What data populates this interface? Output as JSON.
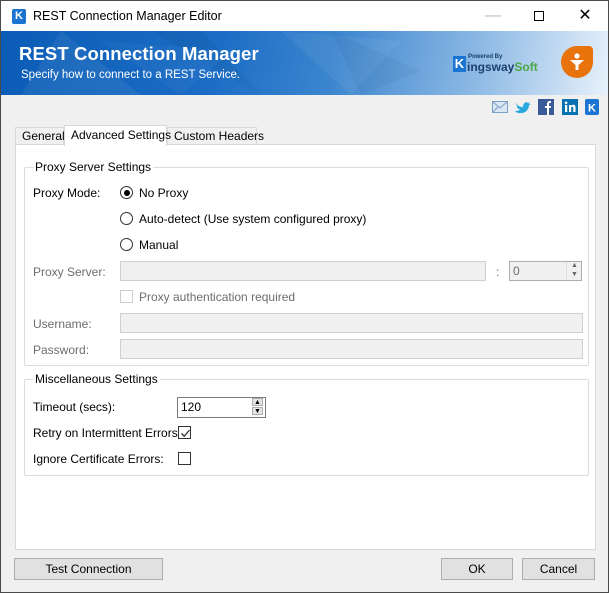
{
  "window": {
    "title": "REST Connection Manager Editor",
    "controls": {
      "minimize": "minimize",
      "maximize": "maximize",
      "close": "close"
    }
  },
  "banner": {
    "title": "REST Connection Manager",
    "subtitle": "Specify how to connect to a REST Service.",
    "logo": {
      "k": "K",
      "powered_by": "Powered By",
      "name_part1": "ingsway",
      "name_part2": "Soft"
    }
  },
  "social_icons": [
    "email-icon",
    "twitter-icon",
    "facebook-icon",
    "linkedin-icon",
    "kingswaysoft-icon"
  ],
  "tabs": [
    {
      "label": "General",
      "active": false
    },
    {
      "label": "Advanced Settings",
      "active": true
    },
    {
      "label": "Custom Headers",
      "active": false
    }
  ],
  "proxy": {
    "group_title": "Proxy Server Settings",
    "mode_label": "Proxy Mode:",
    "options": [
      {
        "label": "No Proxy",
        "selected": true
      },
      {
        "label": "Auto-detect (Use system configured proxy)",
        "selected": false
      },
      {
        "label": "Manual",
        "selected": false
      }
    ],
    "server_label": "Proxy Server:",
    "server_value": "",
    "port_separator": ":",
    "port_value": "0",
    "auth_label": "Proxy authentication required",
    "auth_checked": false,
    "username_label": "Username:",
    "username_value": "",
    "password_label": "Password:",
    "password_value": ""
  },
  "misc": {
    "group_title": "Miscellaneous Settings",
    "timeout_label": "Timeout (secs):",
    "timeout_value": "120",
    "retry_label": "Retry on Intermittent Errors:",
    "retry_checked": true,
    "ignore_cert_label": "Ignore Certificate Errors:",
    "ignore_cert_checked": false
  },
  "footer": {
    "test_connection": "Test Connection",
    "ok": "OK",
    "cancel": "Cancel"
  },
  "colors": {
    "banner_blue": "#1a6cc4",
    "brand_orange": "#e8730c",
    "brand_green": "#4aa845"
  }
}
